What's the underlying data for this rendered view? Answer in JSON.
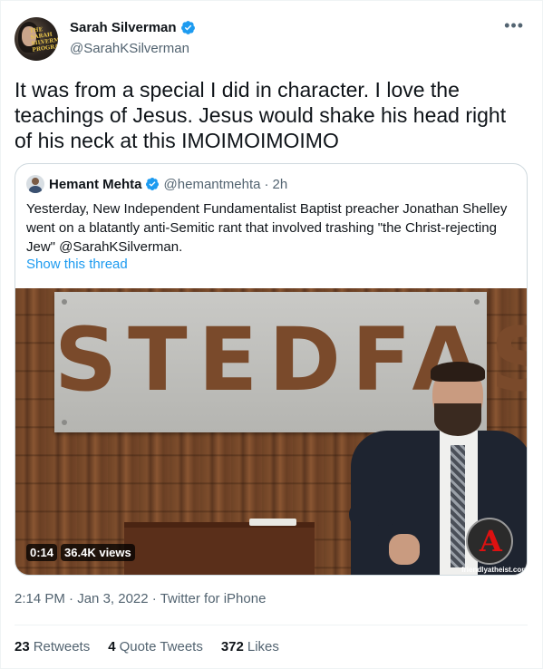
{
  "author": {
    "display_name": "Sarah Silverman",
    "handle": "@SarahKSilverman",
    "verified": true,
    "avatar_text": "THE SARAH SILVERMAN PROGRAM"
  },
  "more_icon": "more-horizontal-icon",
  "tweet": {
    "text": "It was from a special I did in character. I love the teachings of Jesus. Jesus would shake his head right of his neck at this IMOIMOIMOIMO"
  },
  "quoted_tweet": {
    "display_name": "Hemant Mehta",
    "handle": "@hemantmehta",
    "separator": "·",
    "time": "2h",
    "verified": true,
    "text": "Yesterday, New Independent Fundamentalist Baptist preacher Jonathan Shelley went on a blatantly anti-Semitic rant that involved trashing \"the Christ-rejecting Jew\" @SarahKSilverman.",
    "show_thread": "Show this thread",
    "media": {
      "sign_text": "STEDFAST",
      "duration": "0:14",
      "views": "36.4K views",
      "watermark": "friendlyatheist.com"
    }
  },
  "meta": {
    "time": "2:14 PM",
    "sep1": "·",
    "date": "Jan 3, 2022",
    "sep2": "·",
    "source": "Twitter for iPhone"
  },
  "stats": {
    "retweets_count": "23",
    "retweets_label": "Retweets",
    "quotes_count": "4",
    "quotes_label": "Quote Tweets",
    "likes_count": "372",
    "likes_label": "Likes"
  },
  "colors": {
    "verified": "#1d9bf0",
    "link": "#1d9bf0",
    "secondary_text": "#536471"
  }
}
